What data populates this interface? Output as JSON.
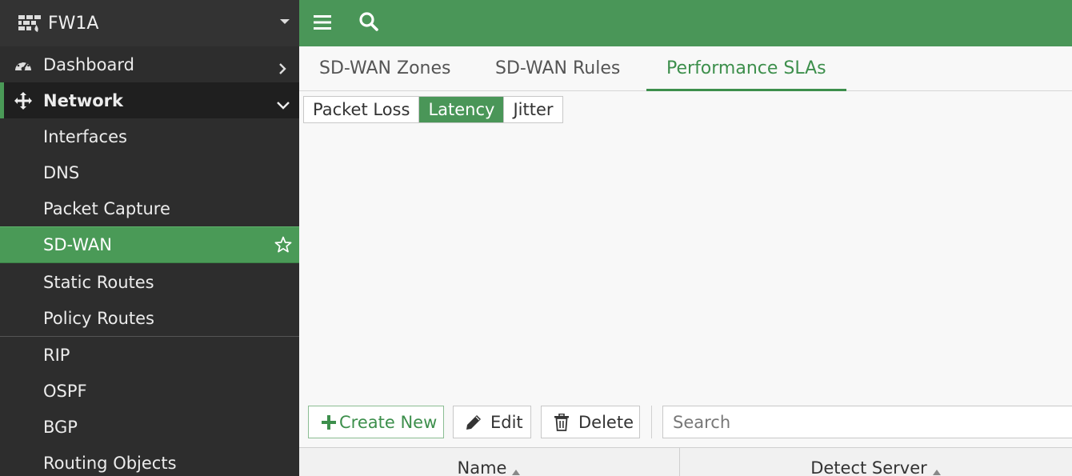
{
  "sidebar": {
    "device_name": "FW1A",
    "items": [
      {
        "label": "Dashboard",
        "icon": "dashboard-gauge-icon"
      },
      {
        "label": "Network",
        "icon": "arrows-move-icon"
      },
      {
        "label": "Interfaces"
      },
      {
        "label": "DNS"
      },
      {
        "label": "Packet Capture"
      },
      {
        "label": "SD-WAN"
      },
      {
        "label": "Static Routes"
      },
      {
        "label": "Policy Routes"
      },
      {
        "label": "RIP"
      },
      {
        "label": "OSPF"
      },
      {
        "label": "BGP"
      },
      {
        "label": "Routing Objects"
      }
    ]
  },
  "tabs": [
    {
      "label": "SD-WAN Zones"
    },
    {
      "label": "SD-WAN Rules"
    },
    {
      "label": "Performance SLAs"
    }
  ],
  "metric_toggle": {
    "options": [
      "Packet Loss",
      "Latency",
      "Jitter"
    ],
    "selected": "Latency"
  },
  "toolbar": {
    "create_label": "Create New",
    "edit_label": "Edit",
    "delete_label": "Delete",
    "search_placeholder": "Search"
  },
  "table": {
    "columns": [
      "Name",
      "Detect Server"
    ]
  },
  "colors": {
    "accent": "#4a9658",
    "sidebar_bg": "#2d2d2d"
  }
}
